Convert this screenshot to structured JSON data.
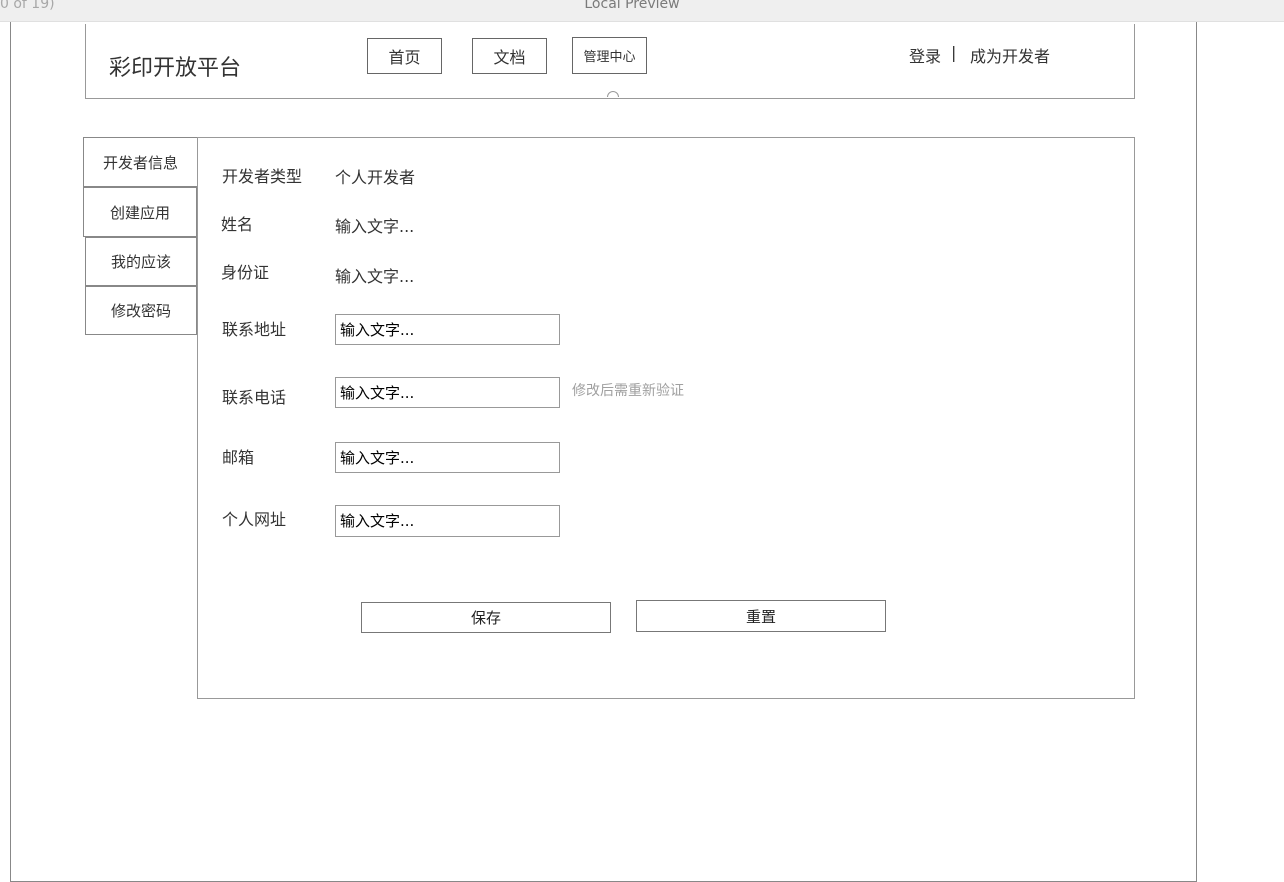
{
  "window": {
    "page_count": "0 of 19)",
    "title": "Local Preview"
  },
  "header": {
    "logo": "彩印开放平台",
    "nav": {
      "home": "首页",
      "docs": "文档",
      "admin": "管理中心"
    },
    "login": "登录",
    "separator": "|",
    "become_developer": "成为开发者"
  },
  "sidebar": {
    "items": [
      {
        "label": "开发者信息"
      },
      {
        "label": "创建应用"
      },
      {
        "label": "我的应该"
      },
      {
        "label": "修改密码"
      }
    ]
  },
  "form": {
    "developer_type": {
      "label": "开发者类型",
      "value": "个人开发者"
    },
    "name": {
      "label": "姓名",
      "value": "输入文字..."
    },
    "id_card": {
      "label": "身份证",
      "value": "输入文字..."
    },
    "address": {
      "label": "联系地址",
      "value": "输入文字..."
    },
    "phone": {
      "label": "联系电话",
      "value": "输入文字...",
      "hint": "修改后需重新验证"
    },
    "email": {
      "label": "邮箱",
      "value": "输入文字..."
    },
    "website": {
      "label": "个人网址",
      "value": "输入文字..."
    }
  },
  "actions": {
    "save": "保存",
    "reset": "重置"
  }
}
